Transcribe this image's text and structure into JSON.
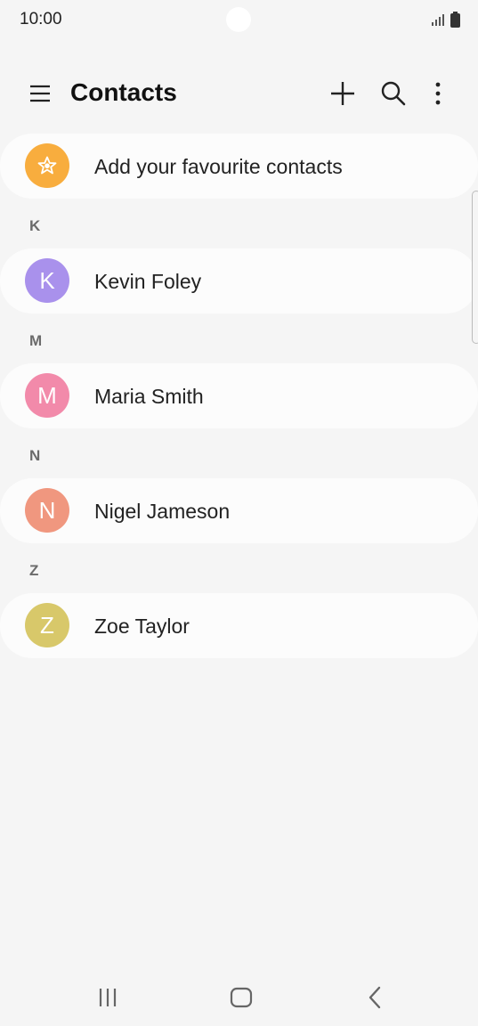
{
  "status_bar": {
    "time": "10:00"
  },
  "header": {
    "title": "Contacts",
    "icons": [
      "menu-icon",
      "add-icon",
      "search-icon",
      "more-options-icon"
    ]
  },
  "favourites": {
    "label": "Add your favourite contacts",
    "icon": "star-icon",
    "color": "#f8ad3e"
  },
  "sections": [
    {
      "letter": "K",
      "contacts": [
        {
          "initial": "K",
          "name": "Kevin Foley",
          "color": "#a991ec"
        }
      ]
    },
    {
      "letter": "M",
      "contacts": [
        {
          "initial": "M",
          "name": "Maria Smith",
          "color": "#f28aaa"
        }
      ]
    },
    {
      "letter": "N",
      "contacts": [
        {
          "initial": "N",
          "name": "Nigel Jameson",
          "color": "#f0977f"
        }
      ]
    },
    {
      "letter": "Z",
      "contacts": [
        {
          "initial": "Z",
          "name": "Zoe Taylor",
          "color": "#d8c86a"
        }
      ]
    }
  ],
  "nav": {
    "icons": [
      "recents-icon",
      "home-icon",
      "back-icon"
    ]
  }
}
